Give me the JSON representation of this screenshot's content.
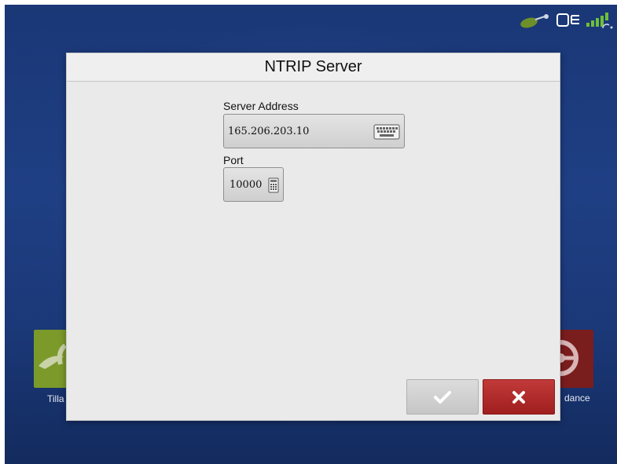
{
  "colors": {
    "background": "#1f3f84",
    "dialog": "#eaeaea",
    "cancel": "#b02626",
    "ok": "#d2d2d2"
  },
  "status_bar": {
    "icons": [
      "implement-icon",
      "display-icon",
      "gps-signal-icon"
    ]
  },
  "background_tiles": {
    "left_label": "Tilla",
    "right_label": "dance"
  },
  "dialog": {
    "title": "NTRIP Server",
    "server_address": {
      "label": "Server Address",
      "value": "165.206.203.10",
      "icon": "keyboard-icon"
    },
    "port": {
      "label": "Port",
      "value": "10000",
      "icon": "keypad-icon"
    },
    "buttons": {
      "ok_icon": "checkmark-icon",
      "cancel_icon": "close-icon"
    }
  }
}
